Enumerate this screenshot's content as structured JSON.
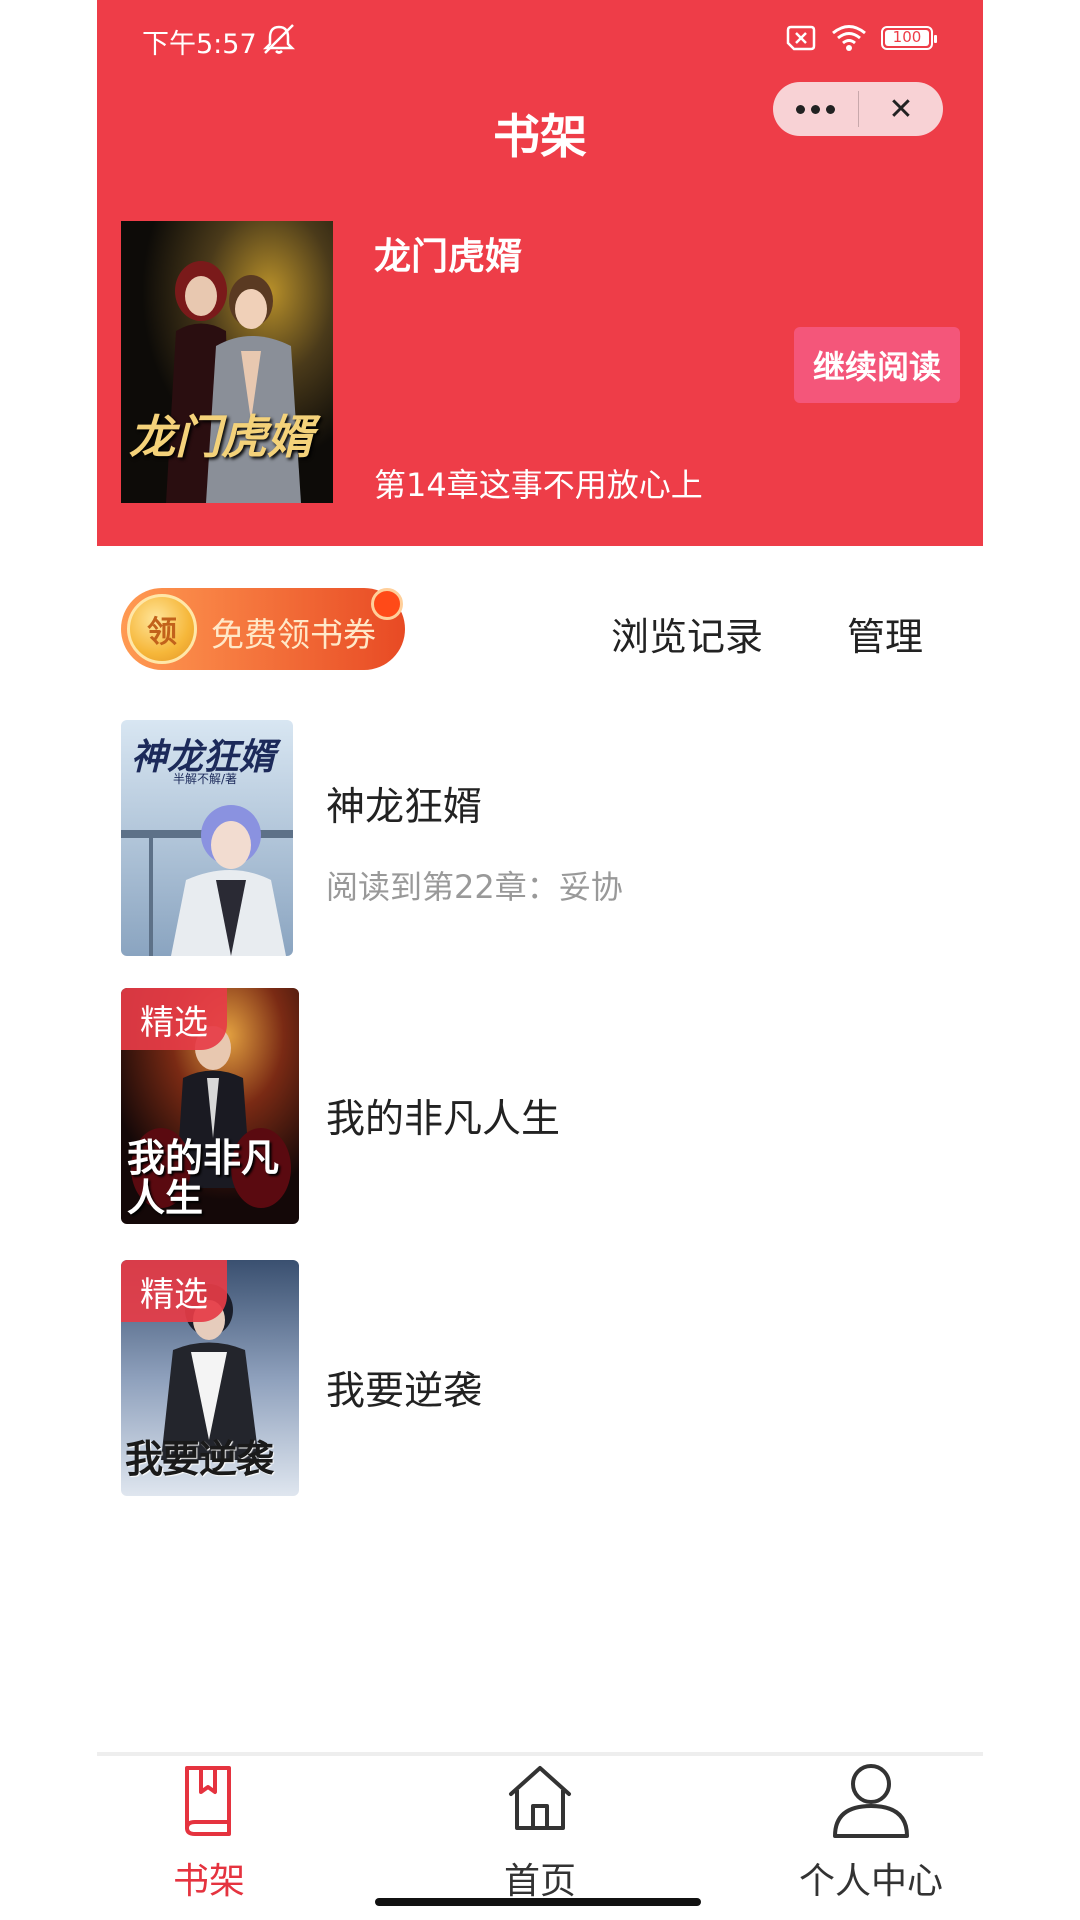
{
  "status_bar": {
    "time": "下午5:57",
    "battery": "100"
  },
  "header": {
    "title": "书架"
  },
  "capsule": {
    "more_label": "•••",
    "close_label": "✕"
  },
  "current_book": {
    "title": "龙门虎婿",
    "chapter": "第14章这事不用放心上",
    "continue_label": "继续阅读",
    "cover_text": "龙门虎婿"
  },
  "toolbar": {
    "coupon_badge": "领",
    "coupon_label": "免费领书券",
    "history_label": "浏览记录",
    "manage_label": "管理"
  },
  "books": [
    {
      "title": "神龙狂婿",
      "progress": "阅读到第22章：妥协",
      "cover_text": "神龙狂婿",
      "cover_author": "半解不解/著"
    },
    {
      "title": "我的非凡人生",
      "tag": "精选",
      "cover_text": "我的非凡人生"
    },
    {
      "title": "我要逆袭",
      "tag": "精选",
      "cover_text": "我要逆袭"
    }
  ],
  "tabbar": {
    "tabs": [
      {
        "label": "书架",
        "icon": "book-icon",
        "active": true
      },
      {
        "label": "首页",
        "icon": "home-icon",
        "active": false
      },
      {
        "label": "个人中心",
        "icon": "user-icon",
        "active": false
      }
    ]
  },
  "colors": {
    "brand": "#ee3d48",
    "accent_button": "#f4567a",
    "active_tab": "#e5333f"
  }
}
